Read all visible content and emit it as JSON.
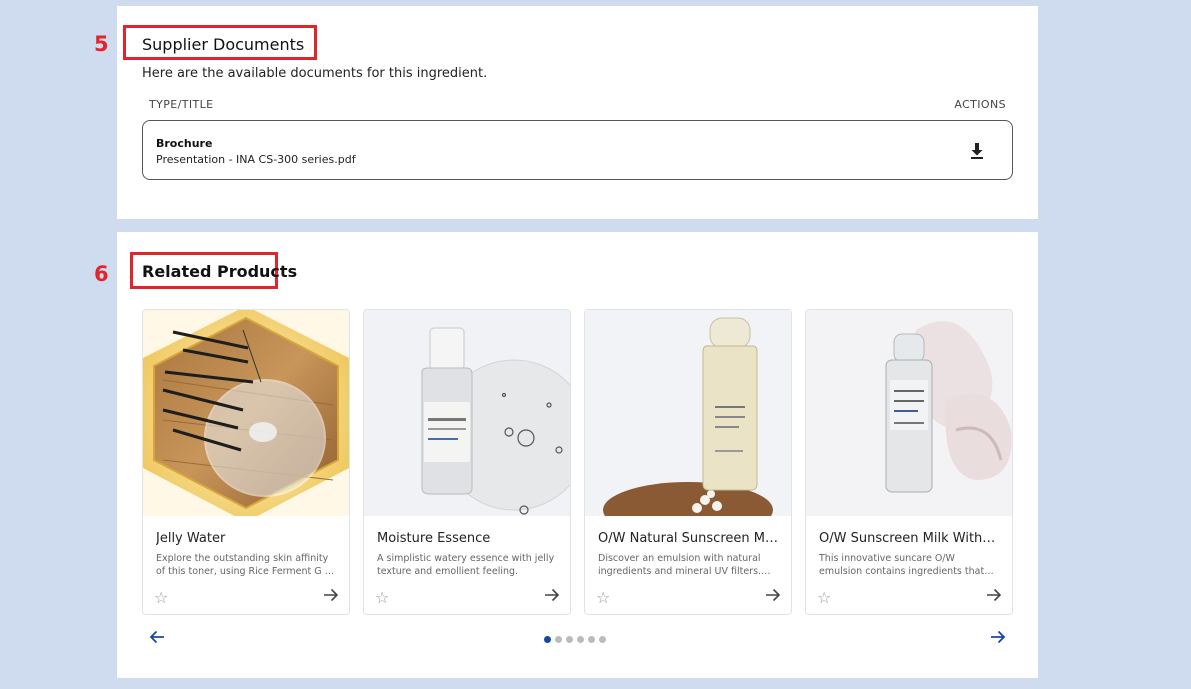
{
  "annotations": {
    "step_5": "5",
    "step_6": "6"
  },
  "supplier_documents": {
    "title": "Supplier Documents",
    "subtitle": "Here are the available documents for this ingredient.",
    "col_type": "TYPE/TITLE",
    "col_actions": "ACTIONS",
    "documents": [
      {
        "type": "Brochure",
        "title": "Presentation - INA CS-300 series.pdf",
        "action_icon": "download-icon"
      }
    ]
  },
  "related_products": {
    "title": "Related Products",
    "items": [
      {
        "name": "Jelly Water",
        "description": "Explore the outstanding skin affinity of this toner, using Rice Ferment G as the main ingredient."
      },
      {
        "name": "Moisture Essence",
        "description": "A simplistic watery essence with jelly texture and emollient feeling."
      },
      {
        "name": "O/W Natural Sunscreen Milk",
        "description": "Discover an emulsion with natural ingredients and mineral UV filters. The formula offers lightweight protection."
      },
      {
        "name": "O/W Sunscreen Milk With…",
        "description": "This innovative suncare O/W emulsion contains ingredients that reduce shine and provide protection."
      }
    ],
    "pagination": {
      "total_pages": 6,
      "current_page": 1
    }
  },
  "colors": {
    "accent": "#1747a6",
    "annotation": "#e0262b",
    "background": "#cfdbee"
  }
}
